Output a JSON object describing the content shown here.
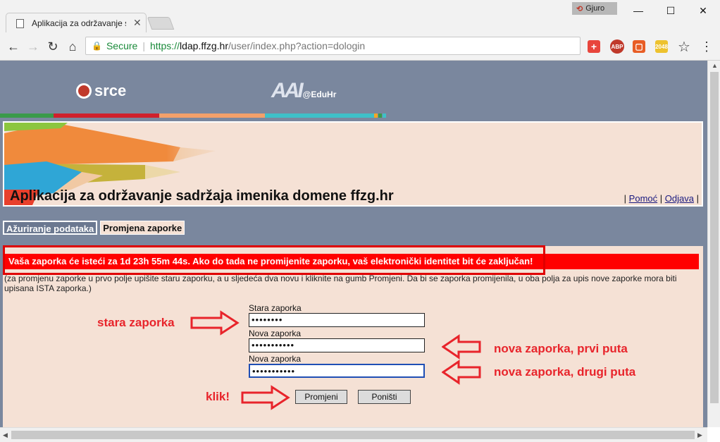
{
  "browser": {
    "tab_title": "Aplikacija za održavanje s",
    "tab_close": "✕",
    "user_name": "Gjuro",
    "window_controls": {
      "minimize": "—",
      "maximize": "☐",
      "close": "✕"
    },
    "nav": {
      "back": "←",
      "forward": "→",
      "reload": "↻",
      "home": "⌂"
    },
    "address": {
      "secure_label": "Secure",
      "protocol": "https://",
      "host": "ldap.ffzg.hr",
      "path": "/user/index.php?action=dologin"
    },
    "extensions": [
      "plus-ext",
      "abp",
      "office",
      "2048"
    ],
    "extension_labels": {
      "abp": "ABP",
      "e2048": "2048"
    },
    "star": "☆",
    "menu": "⋮"
  },
  "header": {
    "srce_logo": "srce",
    "aai_logo": "AAI",
    "eduhr_logo": "@EduHr",
    "page_title": "Aplikacija za održavanje sadržaja imenika domene ffzg.hr",
    "links": {
      "sep": "|",
      "help": "Pomoć",
      "logout": "Odjava"
    }
  },
  "tabs": {
    "update": "Ažuriranje podataka",
    "change_password": "Promjena zaporke"
  },
  "warning": "Vaša zaporka će isteći za 1d 23h 55m 44s. Ako do tada ne promijenite zaporku, vaš elektronički identitet bit će zaključan!",
  "instructions": "(za promjenu zaporke u prvo polje upišite staru zaporku, a u sljedeća dva novu i kliknite na gumb Promjeni. Da bi se zaporka promijenila, u oba polja za upis nove zaporke mora biti upisana ISTA zaporka.)",
  "form": {
    "old_label": "Stara zaporka",
    "old_value": "••••••••",
    "new_label": "Nova zaporka",
    "new_value": "•••••••••••",
    "new2_label": "Nova zaporka",
    "new2_value": "•••••••••••",
    "submit": "Promjeni",
    "reset": "Poništi"
  },
  "annotations": {
    "old": "stara zaporka",
    "new1": "nova zaporka, prvi puta",
    "new2": "nova zaporka, drugi puta",
    "click": "klik!"
  },
  "colors": {
    "page_bg": "#7a879e",
    "content_bg": "#f5e1d5",
    "warning": "#ff0000",
    "annotation": "#e8242b",
    "secure": "#1a8a3a"
  }
}
